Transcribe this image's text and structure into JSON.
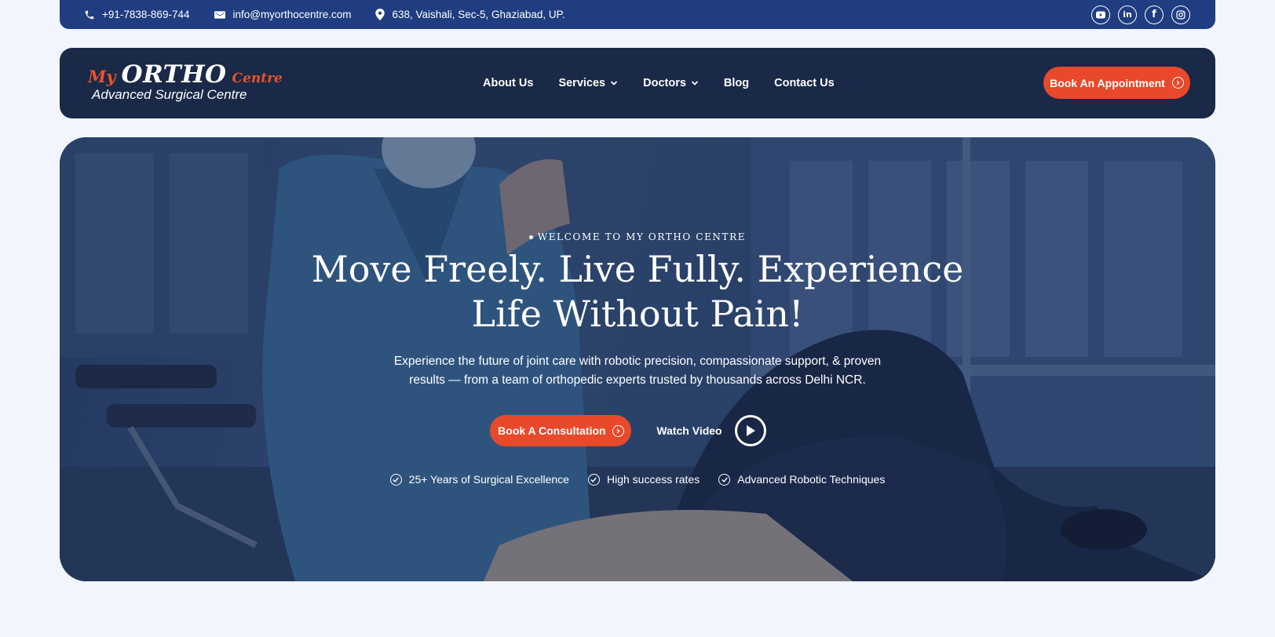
{
  "topbar": {
    "phone": "+91-7838-869-744",
    "email": "info@myorthocentre.com",
    "address": "638, Vaishali, Sec-5, Ghaziabad, UP.",
    "icons": {
      "phone": "phone-icon",
      "email": "envelope-icon",
      "address": "map-pin-icon"
    },
    "socials": [
      "youtube-icon",
      "linkedin-icon",
      "facebook-icon",
      "instagram-icon"
    ]
  },
  "logo": {
    "my": "My",
    "ortho": "ORTHO",
    "centre": "Centre",
    "tagline": "Advanced Surgical Centre"
  },
  "nav": {
    "items": [
      {
        "label": "About Us",
        "dropdown": false
      },
      {
        "label": "Services",
        "dropdown": true
      },
      {
        "label": "Doctors",
        "dropdown": true
      },
      {
        "label": "Blog",
        "dropdown": false
      },
      {
        "label": "Contact Us",
        "dropdown": false
      }
    ],
    "cta": "Book An Appointment"
  },
  "hero": {
    "eyebrow": "WELCOME TO MY ORTHO CENTRE",
    "title_line1": "Move Freely. Live Fully. Experience",
    "title_line2": "Life Without Pain!",
    "desc_line1": "Experience the future of joint care with robotic precision, compassionate support, & proven",
    "desc_line2": "results — from a team of orthopedic experts trusted by thousands across Delhi NCR.",
    "primary_cta": "Book A Consultation",
    "video_label": "Watch Video",
    "features": [
      "25+ Years of Surgical Excellence",
      "High success rates",
      "Advanced Robotic Techniques"
    ]
  },
  "colors": {
    "topbar_bg": "#1f3d80",
    "header_bg": "#192947",
    "accent": "#e8492a",
    "page_bg": "#f2f5fd"
  }
}
